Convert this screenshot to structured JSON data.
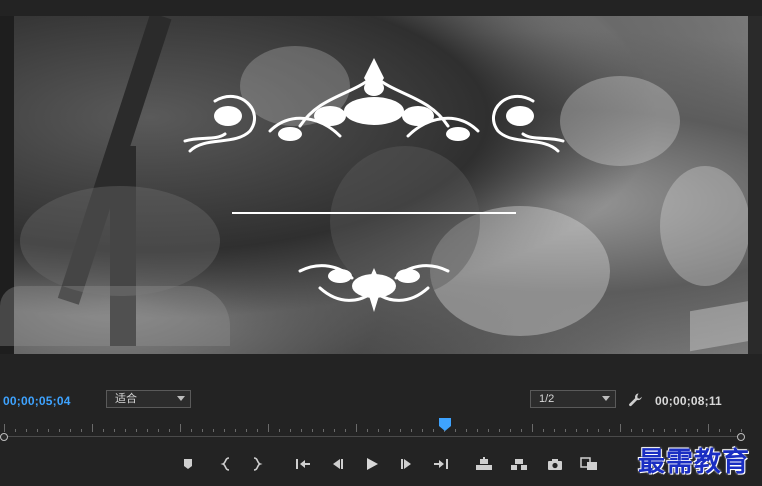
{
  "monitor": {
    "current_timecode": "00;00;05;04",
    "duration_timecode": "00;00;08;11",
    "zoom_select": {
      "selected": "适合"
    },
    "quality_select": {
      "selected": "1/2"
    },
    "playhead_position_fraction": 0.597
  },
  "transport": {
    "buttons": [
      "add-marker",
      "mark-in",
      "mark-out",
      "go-to-in",
      "step-back",
      "play",
      "step-forward",
      "go-to-out",
      "lift",
      "extract",
      "export-frame",
      "comparison-view"
    ]
  },
  "accent_color": "#3ea3ff",
  "watermark": {
    "text": "最需教育",
    "color": "#1a2ec2"
  }
}
